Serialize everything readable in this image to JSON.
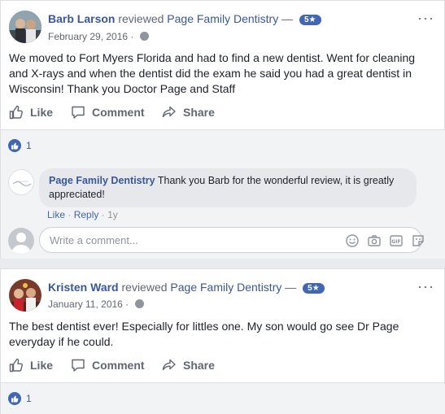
{
  "colors": {
    "brand": "#4267b2",
    "link": "#385898",
    "secondary": "#616770"
  },
  "reviews": [
    {
      "author": "Barb Larson",
      "verb": "reviewed",
      "page": "Page Family Dentistry",
      "dash": "—",
      "rating_label": "5★",
      "rating": 5,
      "date": "February 29, 2016 ·",
      "text": "We moved to Fort Myers Florida and had to find a new dentist. Went for cleaning and X-rays and when the dentist did the exam he said you had a great dentist in Wisconsin! Thank you Doctor Page and Staff",
      "actions": {
        "like": "Like",
        "comment": "Comment",
        "share": "Share"
      },
      "like_count": "1",
      "reply": {
        "author": "Page Family Dentistry",
        "text": "Thank you Barb for the wonderful review, it is greatly appreciated!",
        "like": "Like",
        "reply": "Reply",
        "age": "1y"
      },
      "write_placeholder": "Write a comment..."
    },
    {
      "author": "Kristen Ward",
      "verb": "reviewed",
      "page": "Page Family Dentistry",
      "dash": "—",
      "rating_label": "5★",
      "rating": 5,
      "date": "January 11, 2016 ·",
      "text": "The best dentist ever! Especially for littles one. My son would go see Dr Page everyday if he could.",
      "actions": {
        "like": "Like",
        "comment": "Comment",
        "share": "Share"
      },
      "like_count": "1"
    }
  ]
}
